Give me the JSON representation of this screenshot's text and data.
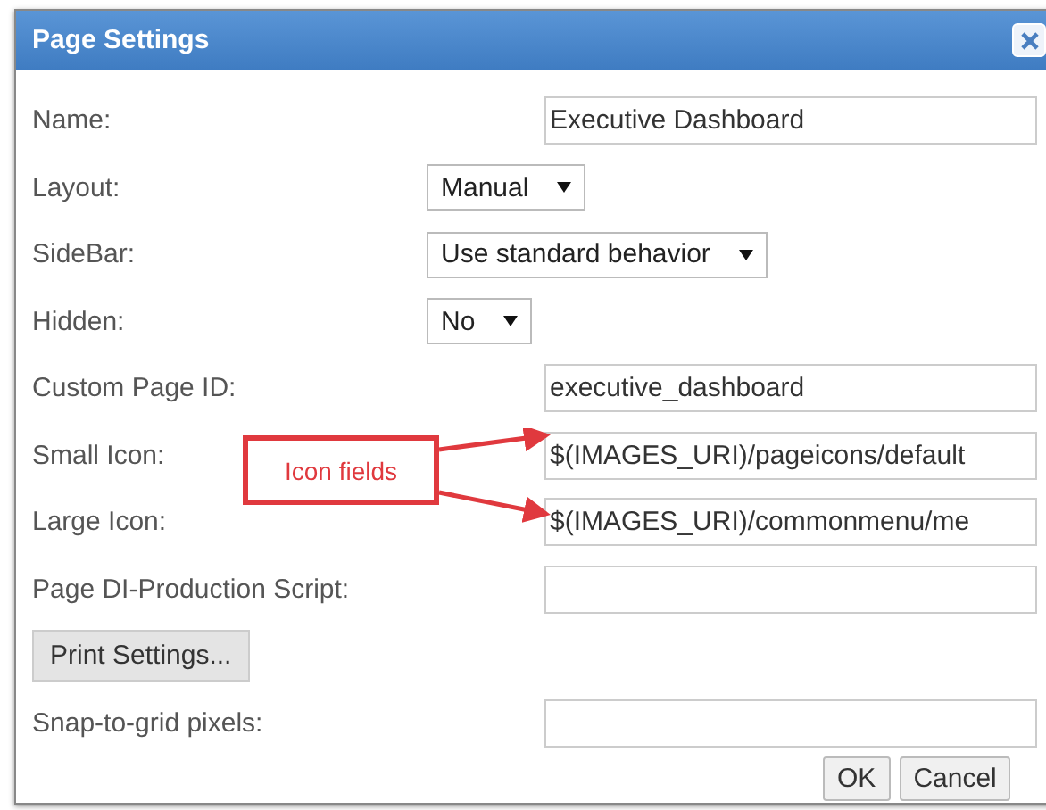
{
  "window": {
    "title": "Page Settings"
  },
  "fields": [
    {
      "kind": "text",
      "label": "Name:",
      "value": "Executive Dashboard"
    },
    {
      "kind": "select",
      "label": "Layout:",
      "value": "Manual"
    },
    {
      "kind": "select",
      "label": "SideBar:",
      "value": "Use standard behavior"
    },
    {
      "kind": "select",
      "label": "Hidden:",
      "value": "No"
    },
    {
      "kind": "text",
      "label": "Custom Page ID:",
      "value": "executive_dashboard"
    },
    {
      "kind": "text",
      "label": "Small Icon:",
      "value": "$(IMAGES_URI)/pageicons/default"
    },
    {
      "kind": "text",
      "label": "Large Icon:",
      "value": "$(IMAGES_URI)/commonmenu/me"
    },
    {
      "kind": "text",
      "label": "Page DI-Production Script:"
    },
    {
      "kind": "button",
      "label": "Print Settings..."
    },
    {
      "kind": "text",
      "label": "Snap-to-grid pixels:"
    }
  ],
  "annotation": {
    "text": "Icon fields"
  },
  "buttons": [
    "OK",
    "Cancel"
  ]
}
